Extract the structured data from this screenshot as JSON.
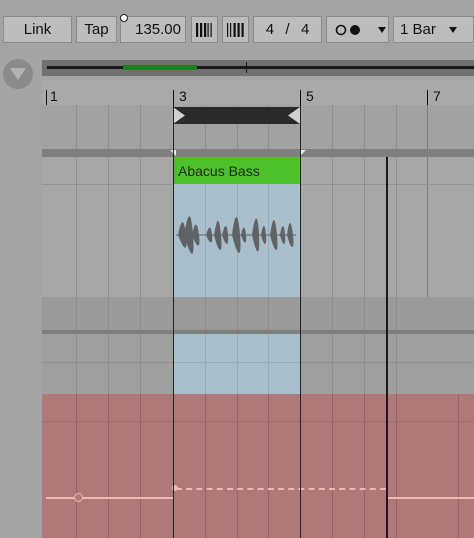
{
  "transport": {
    "link_label": "Link",
    "tap_label": "Tap",
    "tempo": "135.00",
    "signature_numerator": "4",
    "signature_separator": "/",
    "signature_denominator": "4",
    "quantize": "1 Bar"
  },
  "ruler": {
    "markers": [
      "1",
      "3",
      "5",
      "7"
    ]
  },
  "clip": {
    "name": "Abacus Bass",
    "header_color": "#4ec12a",
    "body_color": "#a9bfcb"
  },
  "colors": {
    "automation_lane": "#b07878",
    "automation_line": "#f0b7b7"
  }
}
